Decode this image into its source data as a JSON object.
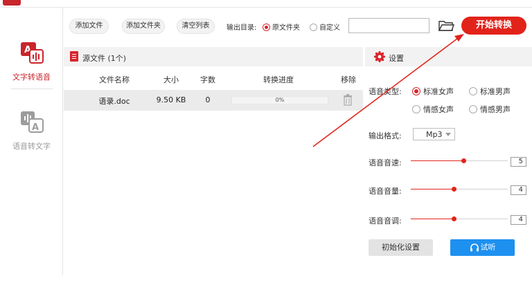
{
  "sidebar": {
    "items": [
      {
        "label": "文字转语音",
        "active": true,
        "icon": "text-to-speech-icon"
      },
      {
        "label": "语音转文字",
        "active": false,
        "icon": "speech-to-text-icon"
      }
    ]
  },
  "toolbar": {
    "add_file": "添加文件",
    "add_folder": "添加文件夹",
    "clear_list": "清空列表",
    "output_label": "输出目录:",
    "output_options": [
      "原文件夹",
      "自定义"
    ],
    "output_selected": "原文件夹",
    "output_path": "",
    "start": "开始转换"
  },
  "files": {
    "title": "源文件 (1个)",
    "columns": [
      "文件名称",
      "大小",
      "字数",
      "转换进度",
      "移除"
    ],
    "rows": [
      {
        "name": "语录.doc",
        "size": "9.50 KB",
        "words": "0",
        "progress_text": "0%",
        "progress": 0
      }
    ]
  },
  "settings": {
    "title": "设置",
    "voice_label": "语音类型:",
    "voices": [
      "标准女声",
      "标准男声",
      "情感女声",
      "情感男声"
    ],
    "voice_selected": "标准女声",
    "format_label": "输出格式:",
    "format": "Mp3",
    "speed_label": "语音音速:",
    "speed": "5",
    "volume_label": "语音音量:",
    "volume": "4",
    "pitch_label": "语音音调:",
    "pitch": "4",
    "slider_fill": {
      "speed": 0.54,
      "volume": 0.44,
      "pitch": 0.44
    },
    "reset": "初始化设置",
    "listen": "试听"
  },
  "colors": {
    "accent": "#e2231a",
    "blue": "#1e90f0"
  }
}
